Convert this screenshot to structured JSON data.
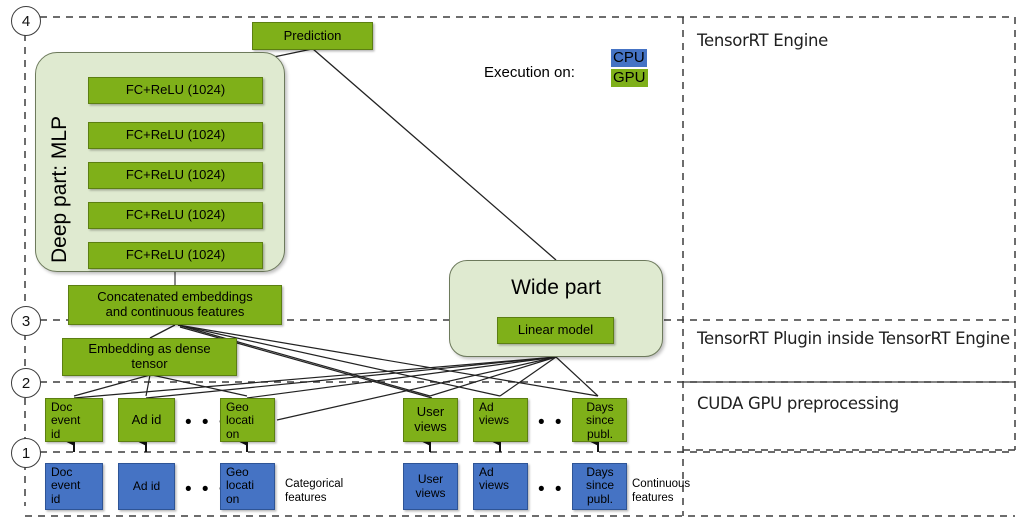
{
  "diagram": {
    "title_right_panel": "TensorRT Engine",
    "legend": {
      "execution_label": "Execution on:",
      "cpu_chip": "CPU",
      "gpu_chip": "GPU",
      "cpu_color": "#4573c4",
      "gpu_color": "#7fb019"
    },
    "stage_labels": [
      {
        "number": "4",
        "text": "TensorRT Engine"
      },
      {
        "number": "3",
        "text": "TensorRT Plugin inside TensorRT Engine"
      },
      {
        "number": "2",
        "text": "CUDA GPU preprocessing"
      },
      {
        "number": "1",
        "text": ""
      }
    ],
    "side_labels": {
      "tensorrt_engine": "TensorRT Engine",
      "tensorrt_plugin": "TensorRT Plugin inside TensorRT Engine",
      "cuda_preprocessing": "CUDA GPU preprocessing"
    },
    "prediction": "Prediction",
    "deep_part": {
      "label": "Deep part: MLP",
      "layers": [
        "FC+ReLU (1024)",
        "FC+ReLU (1024)",
        "FC+ReLU (1024)",
        "FC+ReLU (1024)",
        "FC+ReLU (1024)"
      ]
    },
    "concatenated": "Concatenated embeddings\nand continuous features",
    "concatenated_line1": "Concatenated embeddings",
    "concatenated_line2": "and continuous features",
    "embedding": "Embedding as dense\ntensor",
    "embedding_line1": "Embedding as dense",
    "embedding_line2": "tensor",
    "wide_part": {
      "label": "Wide part",
      "inner": "Linear model"
    },
    "preprocessed_features": [
      {
        "lines": [
          "Doc",
          "event",
          "id"
        ]
      },
      {
        "lines": [
          "Ad id"
        ]
      },
      {
        "lines": [
          "Geo",
          "locati",
          "on"
        ]
      },
      {
        "lines": [
          "User",
          "views"
        ]
      },
      {
        "lines": [
          "Ad",
          "views"
        ]
      },
      {
        "lines": [
          "Days",
          "since",
          "publ."
        ]
      }
    ],
    "raw_features": [
      {
        "lines": [
          "Doc",
          "event",
          "id"
        ]
      },
      {
        "lines": [
          "Ad id"
        ]
      },
      {
        "lines": [
          "Geo",
          "locati",
          "on"
        ]
      },
      {
        "lines": [
          "User",
          "views"
        ]
      },
      {
        "lines": [
          "Ad",
          "views"
        ]
      },
      {
        "lines": [
          "Days",
          "since",
          "publ."
        ]
      }
    ],
    "feature_group_labels": {
      "categorical_line1": "Categorical",
      "categorical_line2": "features",
      "continuous_line1": "Continuous",
      "continuous_line2": "features"
    },
    "ellipsis": "• • •",
    "colors": {
      "green": "#7fb019",
      "blue": "#4573c4",
      "panel_green": "#dfead0",
      "line": "#3d3d3d"
    }
  }
}
